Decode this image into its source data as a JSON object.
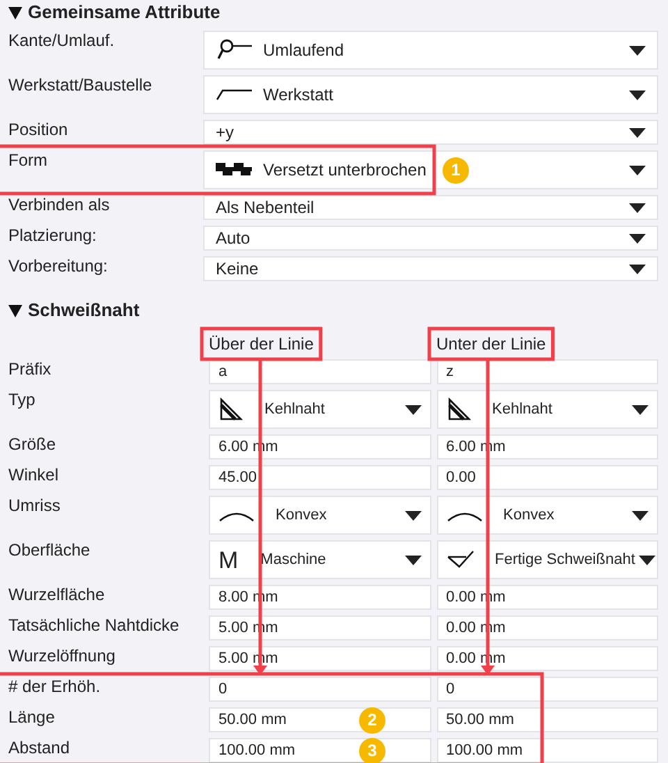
{
  "common": {
    "title": "Gemeinsame Attribute",
    "expanded": true,
    "rows": [
      {
        "label": "Kante/Umlauf.",
        "value": "Umlaufend"
      },
      {
        "label": "Werkstatt/Baustelle",
        "value": "Werkstatt"
      },
      {
        "label": "Position",
        "value": "+y"
      },
      {
        "label": "Form",
        "value": "Versetzt unterbrochen"
      },
      {
        "label": "Verbinden als",
        "value": "Als Nebenteil"
      },
      {
        "label": "Platzierung:",
        "value": "Auto"
      },
      {
        "label": "Vorbereitung:",
        "value": "Keine"
      }
    ]
  },
  "weld": {
    "title": "Schweißnaht",
    "expanded": true,
    "columns": [
      {
        "label": "Über der Linie"
      },
      {
        "label": "Unter der Linie"
      }
    ],
    "rows": [
      {
        "label": "Präfix",
        "kind": "text",
        "cells": [
          {
            "value": "a"
          },
          {
            "value": "z"
          }
        ]
      },
      {
        "label": "Typ",
        "kind": "dropdown",
        "cells": [
          {
            "value": "Kehlnaht"
          },
          {
            "value": "Kehlnaht"
          }
        ]
      },
      {
        "label": "Größe",
        "kind": "text",
        "cells": [
          {
            "value": "6.00 mm"
          },
          {
            "value": "6.00 mm"
          }
        ]
      },
      {
        "label": "Winkel",
        "kind": "text",
        "cells": [
          {
            "value": "45.00"
          },
          {
            "value": "0.00"
          }
        ]
      },
      {
        "label": "Umriss",
        "kind": "dropdown",
        "cells": [
          {
            "value": "Konvex"
          },
          {
            "value": "Konvex"
          }
        ]
      },
      {
        "label": "Oberfläche",
        "kind": "dropdown",
        "cells": [
          {
            "value": "Maschine",
            "icon_text": "M"
          },
          {
            "value": "Fertige Schweißnaht"
          }
        ]
      },
      {
        "label": "Wurzelfläche",
        "kind": "text",
        "cells": [
          {
            "value": "8.00 mm"
          },
          {
            "value": "0.00 mm"
          }
        ]
      },
      {
        "label": "Tatsächliche Nahtdicke",
        "kind": "text",
        "cells": [
          {
            "value": "5.00 mm"
          },
          {
            "value": "0.00 mm"
          }
        ]
      },
      {
        "label": "Wurzelöffnung",
        "kind": "text",
        "cells": [
          {
            "value": "5.00 mm"
          },
          {
            "value": "0.00 mm"
          }
        ]
      },
      {
        "label": "# der Erhöh.",
        "kind": "text",
        "cells": [
          {
            "value": "0"
          },
          {
            "value": "0"
          }
        ]
      },
      {
        "label": "Länge",
        "kind": "text",
        "cells": [
          {
            "value": "50.00 mm"
          },
          {
            "value": "50.00 mm"
          }
        ]
      },
      {
        "label": "Abstand",
        "kind": "text",
        "cells": [
          {
            "value": "100.00 mm"
          },
          {
            "value": "100.00 mm"
          }
        ]
      }
    ]
  },
  "annotations": {
    "badges": [
      {
        "text": "1"
      },
      {
        "text": "2"
      },
      {
        "text": "3"
      }
    ]
  }
}
